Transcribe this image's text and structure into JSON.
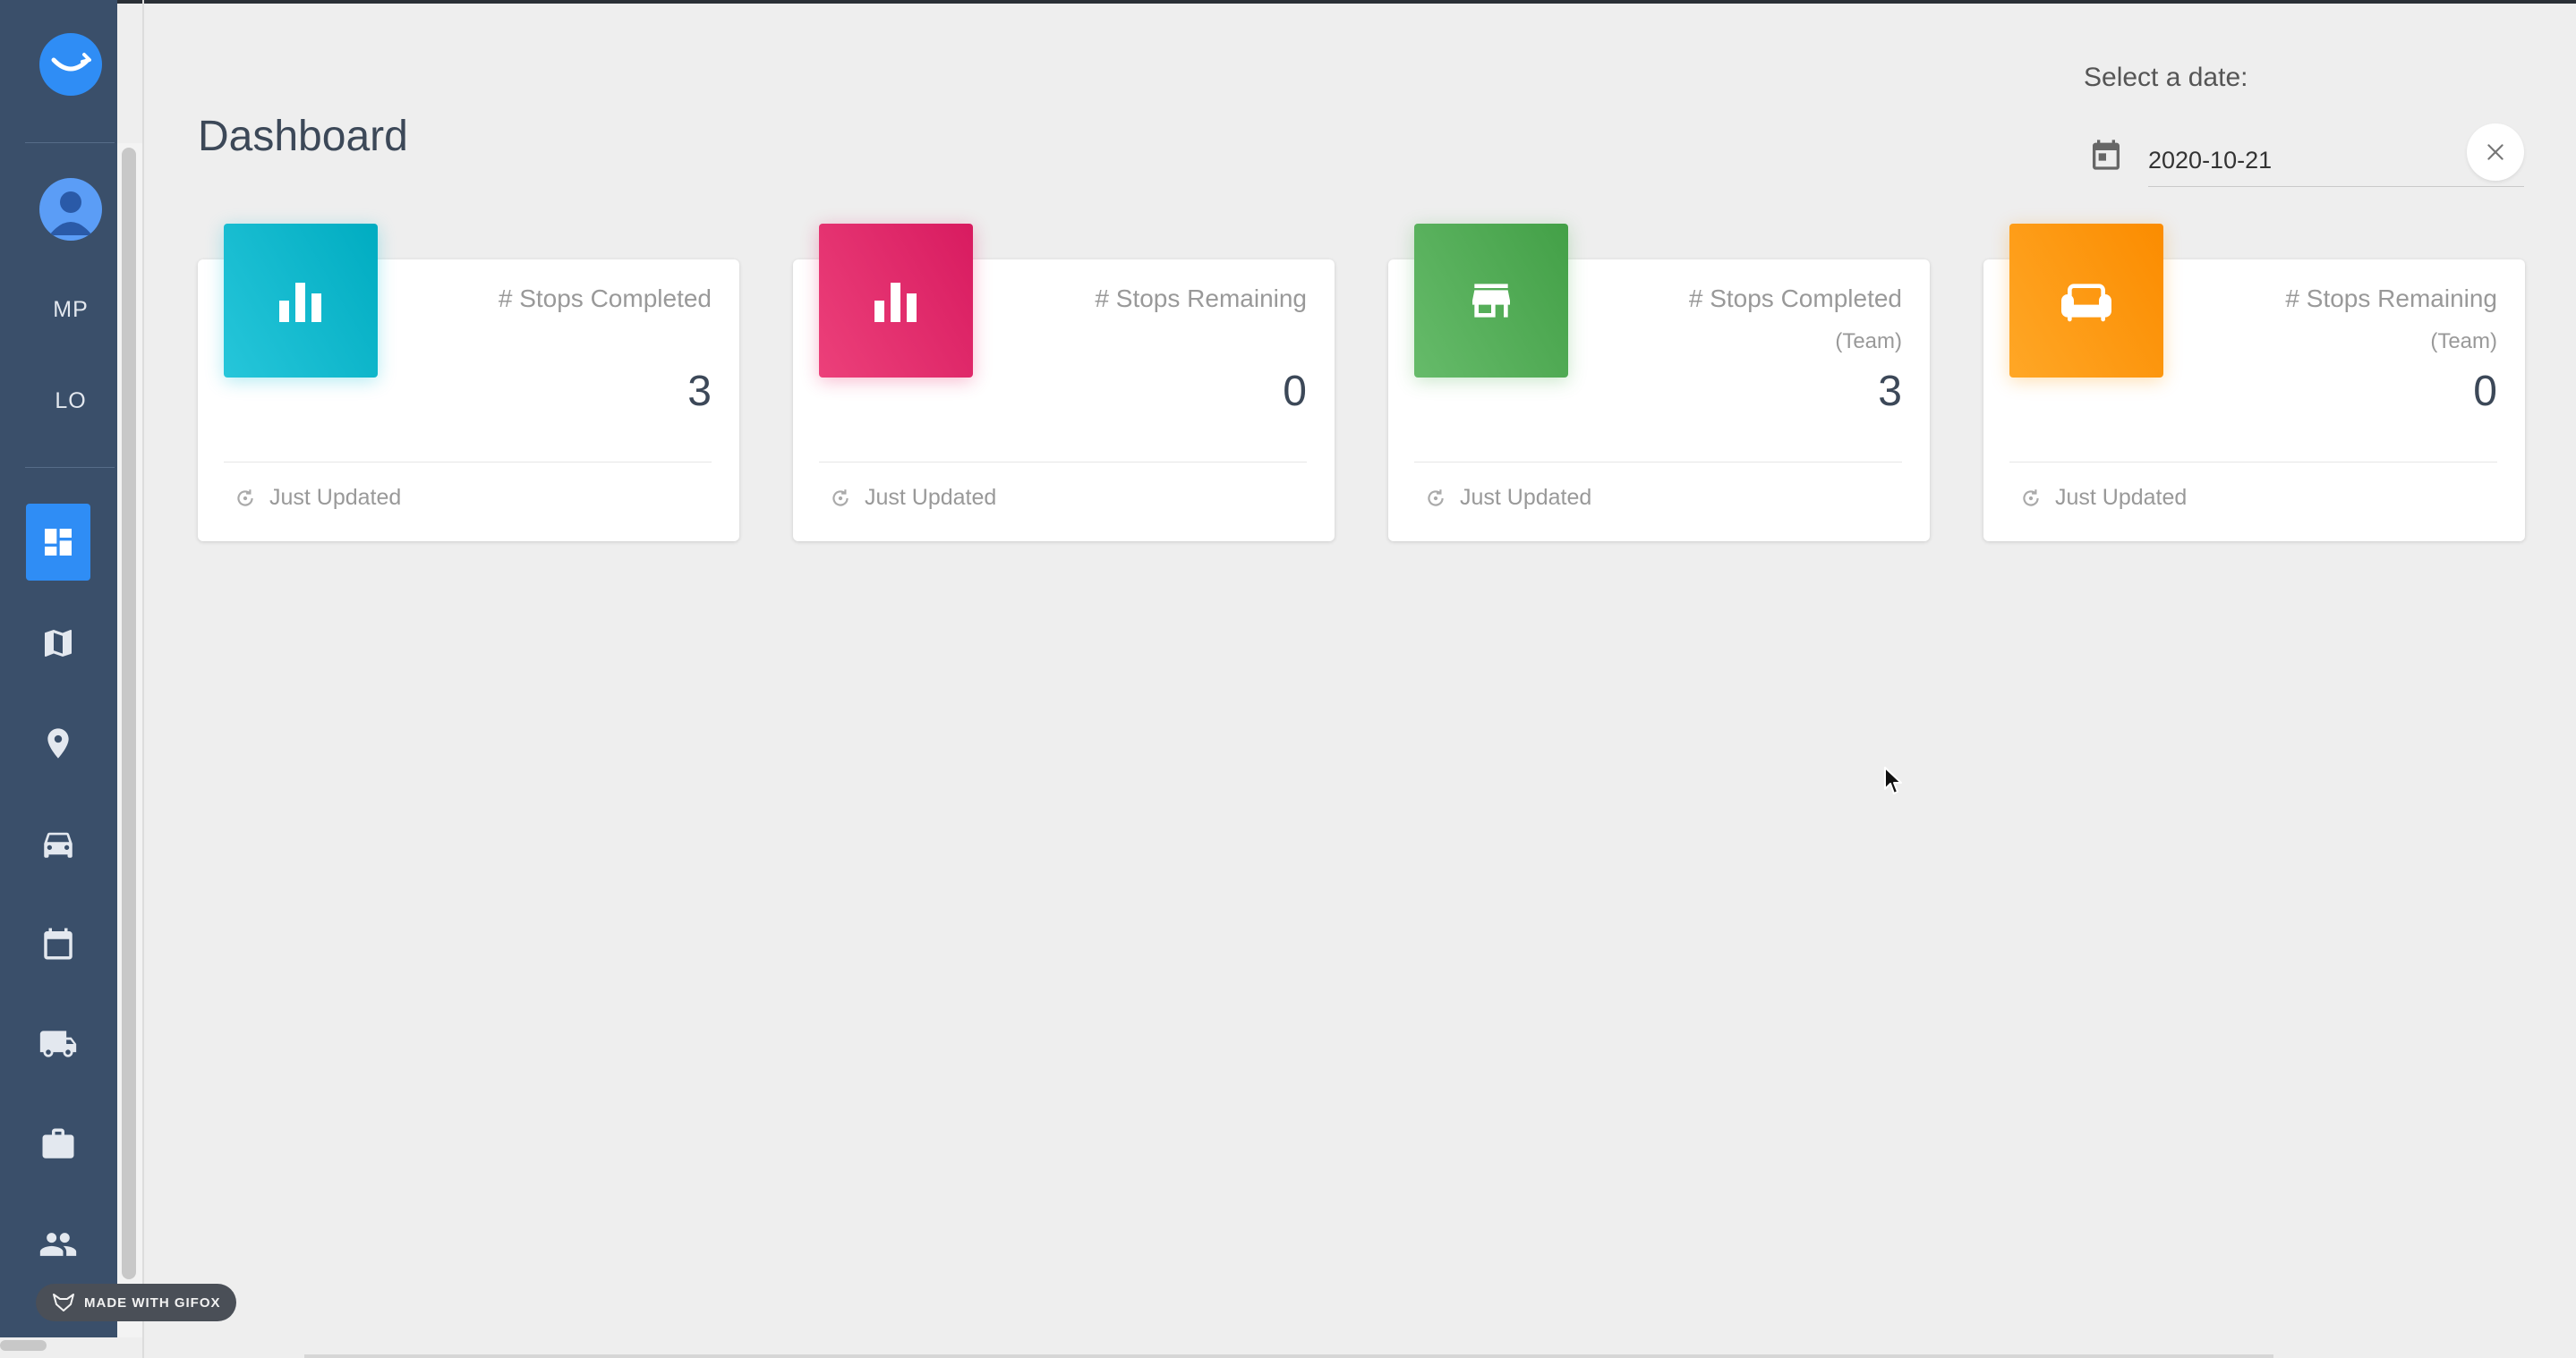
{
  "sidebar": {
    "initials_1": "MP",
    "initials_2": "LO",
    "nav_items": [
      {
        "icon": "dashboard-icon",
        "active": true
      },
      {
        "icon": "map-icon",
        "active": false
      },
      {
        "icon": "location-pin-icon",
        "active": false
      },
      {
        "icon": "car-icon",
        "active": false
      },
      {
        "icon": "calendar-icon",
        "active": false
      },
      {
        "icon": "truck-icon",
        "active": false
      },
      {
        "icon": "briefcase-icon",
        "active": false
      },
      {
        "icon": "people-icon",
        "active": false
      }
    ]
  },
  "page": {
    "title": "Dashboard"
  },
  "date_picker": {
    "label": "Select a date:",
    "value": "2020-10-21"
  },
  "cards": [
    {
      "title": "# Stops Completed",
      "subtitle": "",
      "value": "3",
      "footer": "Just Updated",
      "icon": "bar-chart-icon",
      "color": "#26c6da"
    },
    {
      "title": "# Stops Remaining",
      "subtitle": "",
      "value": "0",
      "footer": "Just Updated",
      "icon": "bar-chart-icon",
      "color": "#ec407a"
    },
    {
      "title": "# Stops Completed",
      "subtitle": "(Team)",
      "value": "3",
      "footer": "Just Updated",
      "icon": "store-icon",
      "color": "#66bb6a"
    },
    {
      "title": "# Stops Remaining",
      "subtitle": "(Team)",
      "value": "0",
      "footer": "Just Updated",
      "icon": "couch-icon",
      "color": "#ffa726"
    }
  ],
  "watermark": {
    "text": "MADE WITH GIFOX"
  },
  "colors": {
    "sidebar_bg": "#3a4f6a",
    "accent": "#2f8df5",
    "page_bg": "#eeeeee"
  }
}
